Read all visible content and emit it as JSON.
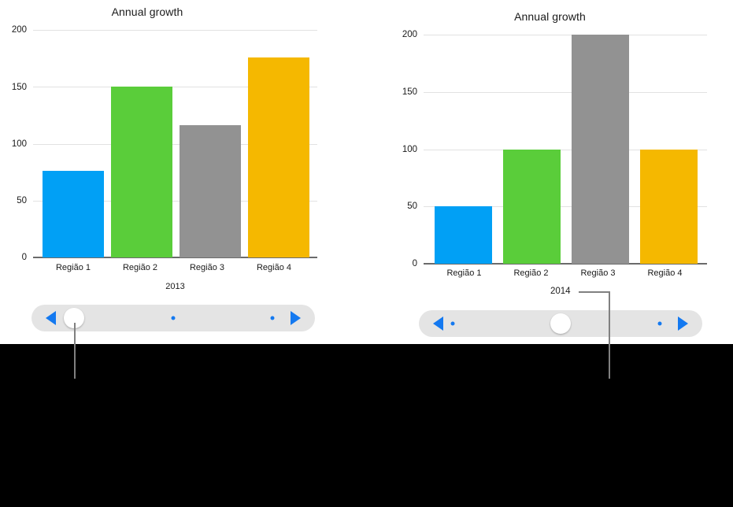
{
  "charts": [
    {
      "title": "Annual growth",
      "xlabel": "2013",
      "yticks": [
        "200",
        "150",
        "100",
        "50",
        "0"
      ],
      "categories": [
        "Região 1",
        "Região 2",
        "Região 3",
        "Região 4"
      ],
      "values": [
        76,
        150,
        116,
        176
      ]
    },
    {
      "title": "Annual growth",
      "xlabel": "2014",
      "yticks": [
        "200",
        "150",
        "100",
        "50",
        "0"
      ],
      "categories": [
        "Região 1",
        "Região 2",
        "Região 3",
        "Região 4"
      ],
      "values": [
        50,
        100,
        200,
        100
      ]
    }
  ],
  "chart_data": [
    {
      "type": "bar",
      "title": "Annual growth",
      "xlabel": "2013",
      "ylabel": "",
      "categories": [
        "Região 1",
        "Região 2",
        "Região 3",
        "Região 4"
      ],
      "values": [
        76,
        150,
        116,
        176
      ],
      "ylim": [
        0,
        200
      ],
      "yticks": [
        0,
        50,
        100,
        150,
        200
      ],
      "grid": true,
      "legend": "none",
      "bar_colors": [
        "#01a0f5",
        "#5acd3a",
        "#929292",
        "#f5b800"
      ]
    },
    {
      "type": "bar",
      "title": "Annual growth",
      "xlabel": "2014",
      "ylabel": "",
      "categories": [
        "Região 1",
        "Região 2",
        "Região 3",
        "Região 4"
      ],
      "values": [
        50,
        100,
        200,
        100
      ],
      "ylim": [
        0,
        200
      ],
      "yticks": [
        0,
        50,
        100,
        150,
        200
      ],
      "grid": true,
      "legend": "none",
      "bar_colors": [
        "#01a0f5",
        "#5acd3a",
        "#929292",
        "#f5b800"
      ]
    }
  ],
  "sliders": {
    "left": {
      "prev_label": "previous",
      "next_label": "next",
      "knob_position_pct": 8,
      "dot_positions_pct": [
        50,
        85
      ]
    },
    "right": {
      "prev_label": "previous",
      "next_label": "next",
      "knob_position_pct": 50,
      "dot_positions_pct": [
        12,
        85
      ]
    }
  },
  "callouts": [
    {
      "label": ""
    },
    {
      "label": "2014"
    }
  ],
  "colors": {
    "series_blue": "#01a0f5",
    "series_green": "#5acd3a",
    "series_gray": "#929292",
    "series_orange": "#f5b800",
    "accent_blue": "#1479f0",
    "grid": "#e2e2e2",
    "axis": "#6b6b6b",
    "slider_track": "#e4e4e4",
    "background": "#000000",
    "canvas": "#ffffff"
  }
}
